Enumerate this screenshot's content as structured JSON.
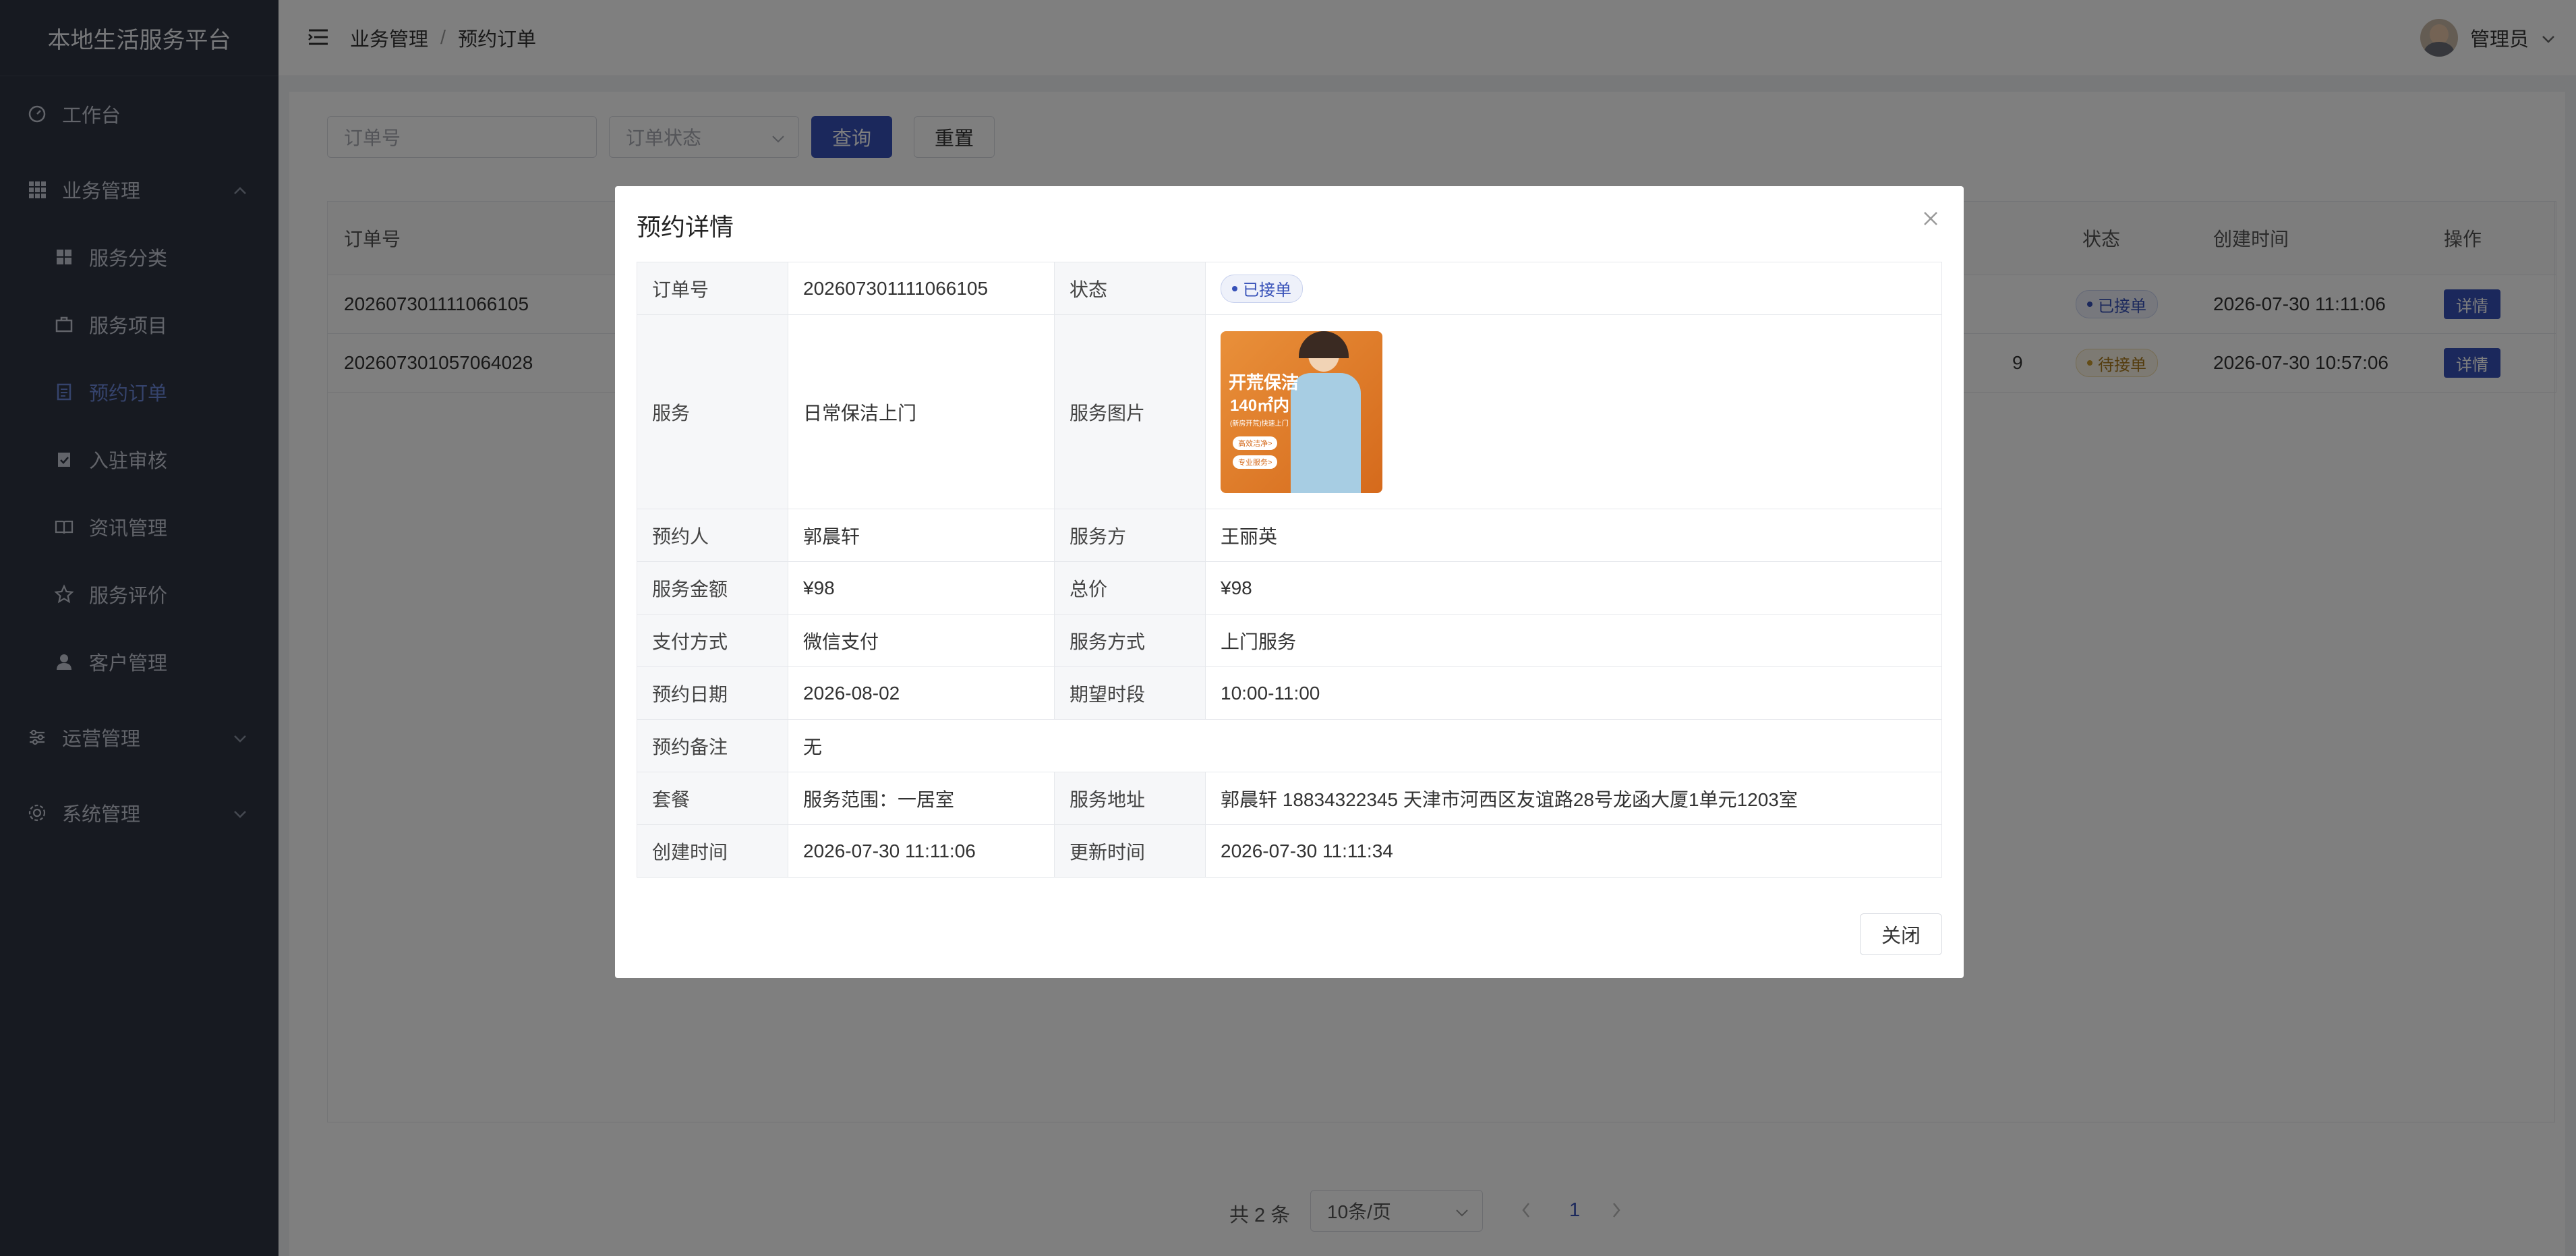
{
  "app": {
    "title": "本地生活服务平台"
  },
  "sidebar": {
    "items": [
      {
        "label": "工作台",
        "icon": "dashboard-icon"
      },
      {
        "label": "业务管理",
        "icon": "grid-icon",
        "expanded": true
      },
      {
        "label": "服务分类",
        "icon": "category-icon"
      },
      {
        "label": "服务项目",
        "icon": "briefcase-icon"
      },
      {
        "label": "预约订单",
        "icon": "document-icon",
        "active": true
      },
      {
        "label": "入驻审核",
        "icon": "clipboard-check-icon"
      },
      {
        "label": "资讯管理",
        "icon": "book-icon"
      },
      {
        "label": "服务评价",
        "icon": "star-icon"
      },
      {
        "label": "客户管理",
        "icon": "user-icon"
      },
      {
        "label": "运营管理",
        "icon": "sliders-icon",
        "expanded": false
      },
      {
        "label": "系统管理",
        "icon": "gear-icon",
        "expanded": false
      }
    ]
  },
  "header": {
    "breadcrumb": [
      "业务管理",
      "预约订单"
    ],
    "separator": "/",
    "user_name": "管理员"
  },
  "filters": {
    "order_no_placeholder": "订单号",
    "status_placeholder": "订单状态",
    "query_label": "查询",
    "reset_label": "重置"
  },
  "table": {
    "columns": {
      "order_no": "订单号",
      "status": "状态",
      "created": "创建时间",
      "ops": "操作"
    },
    "rows": [
      {
        "order_no": "202607301111066105",
        "status": "已接单",
        "created": "2026-07-30 11:11:06",
        "op": "详情",
        "partial": ""
      },
      {
        "order_no": "202607301057064028",
        "status": "待接单",
        "created": "2026-07-30 10:57:06",
        "op": "详情",
        "partial": "9"
      }
    ]
  },
  "pagination": {
    "total": "共 2 条",
    "page_size": "10条/页",
    "current": "1"
  },
  "modal": {
    "title": "预约详情",
    "close_label": "关闭",
    "labels": {
      "order_no": "订单号",
      "status": "状态",
      "service": "服务",
      "service_image": "服务图片",
      "booker": "预约人",
      "provider": "服务方",
      "amount": "服务金额",
      "total": "总价",
      "pay_method": "支付方式",
      "service_mode": "服务方式",
      "date": "预约日期",
      "time_slot": "期望时段",
      "remark": "预约备注",
      "package": "套餐",
      "address": "服务地址",
      "created": "创建时间",
      "updated": "更新时间"
    },
    "values": {
      "order_no": "202607301111066105",
      "status": "已接单",
      "service": "日常保洁上门",
      "booker": "郭晨轩",
      "provider": "王丽英",
      "amount": "¥98",
      "total": "¥98",
      "pay_method": "微信支付",
      "service_mode": "上门服务",
      "date": "2026-08-02",
      "time_slot": "10:00-11:00",
      "remark": "无",
      "package": "服务范围：一居室",
      "address": "郭晨轩 18834322345 天津市河西区友谊路28号龙函大厦1单元1203室",
      "created": "2026-07-30 11:11:06",
      "updated": "2026-07-30 11:11:34"
    },
    "image_text": {
      "line1": "开荒保洁",
      "line2": "140㎡内",
      "line3": "(新房开荒)快速上门",
      "btn1": "高效洁净>",
      "btn2": "专业服务>"
    }
  },
  "colors": {
    "sidebar": "#2e3442",
    "primary": "#3650b8",
    "active_menu": "#6b86d8",
    "tag_accepted": "#3650b8",
    "tag_pending": "#b8860b"
  }
}
